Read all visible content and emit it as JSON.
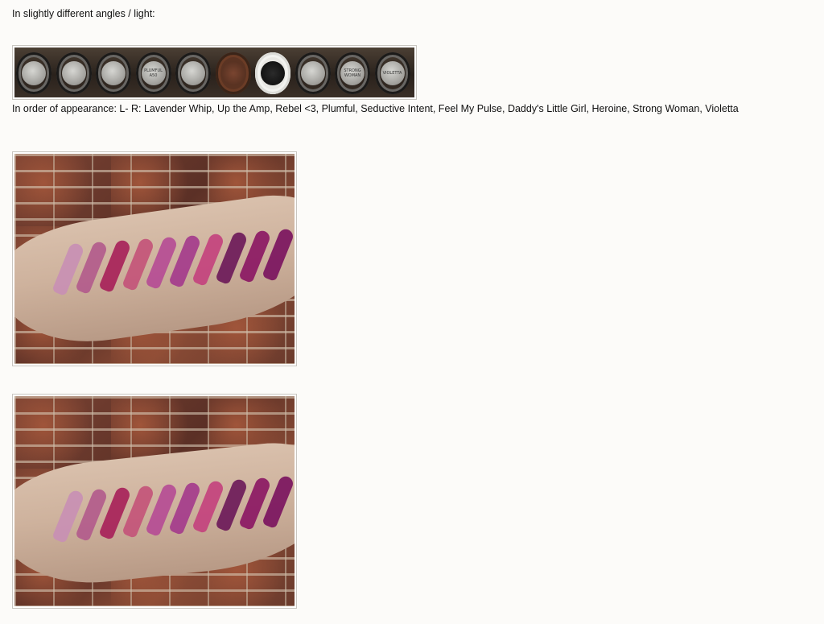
{
  "intro_text": "In slightly different angles / light:",
  "order_text": "In order of appearance: L- R: Lavender Whip, Up the Amp, Rebel <3, Plumful, Seductive Intent, Feel My Pulse, Daddy's Little Girl, Heroine, Strong Woman, Violetta",
  "images": {
    "lipstick_strip_alt": "Lipstick bullets lined up",
    "swatch_photo_1_alt": "Lipstick swatches on arm",
    "swatch_photo_2_alt": "Lipstick swatches on arm, different angle"
  },
  "caps": [
    {
      "label": "",
      "style": "silver"
    },
    {
      "label": "",
      "style": "silver"
    },
    {
      "label": "",
      "style": "silver"
    },
    {
      "label": "PLUMFUL A50",
      "style": "silver"
    },
    {
      "label": "",
      "style": "silver"
    },
    {
      "label": "",
      "style": "brown"
    },
    {
      "label": "",
      "style": "white"
    },
    {
      "label": "",
      "style": "silver"
    },
    {
      "label": "STRONG WOMAN",
      "style": "silver"
    },
    {
      "label": "VIOLETTA",
      "style": "silver"
    }
  ],
  "swatch_colors": [
    "#c890b4",
    "#b35c8c",
    "#a8245a",
    "#c4557a",
    "#b64d94",
    "#a53c8c",
    "#c4447e",
    "#6e1c5a",
    "#8c1a64",
    "#7c1660"
  ]
}
